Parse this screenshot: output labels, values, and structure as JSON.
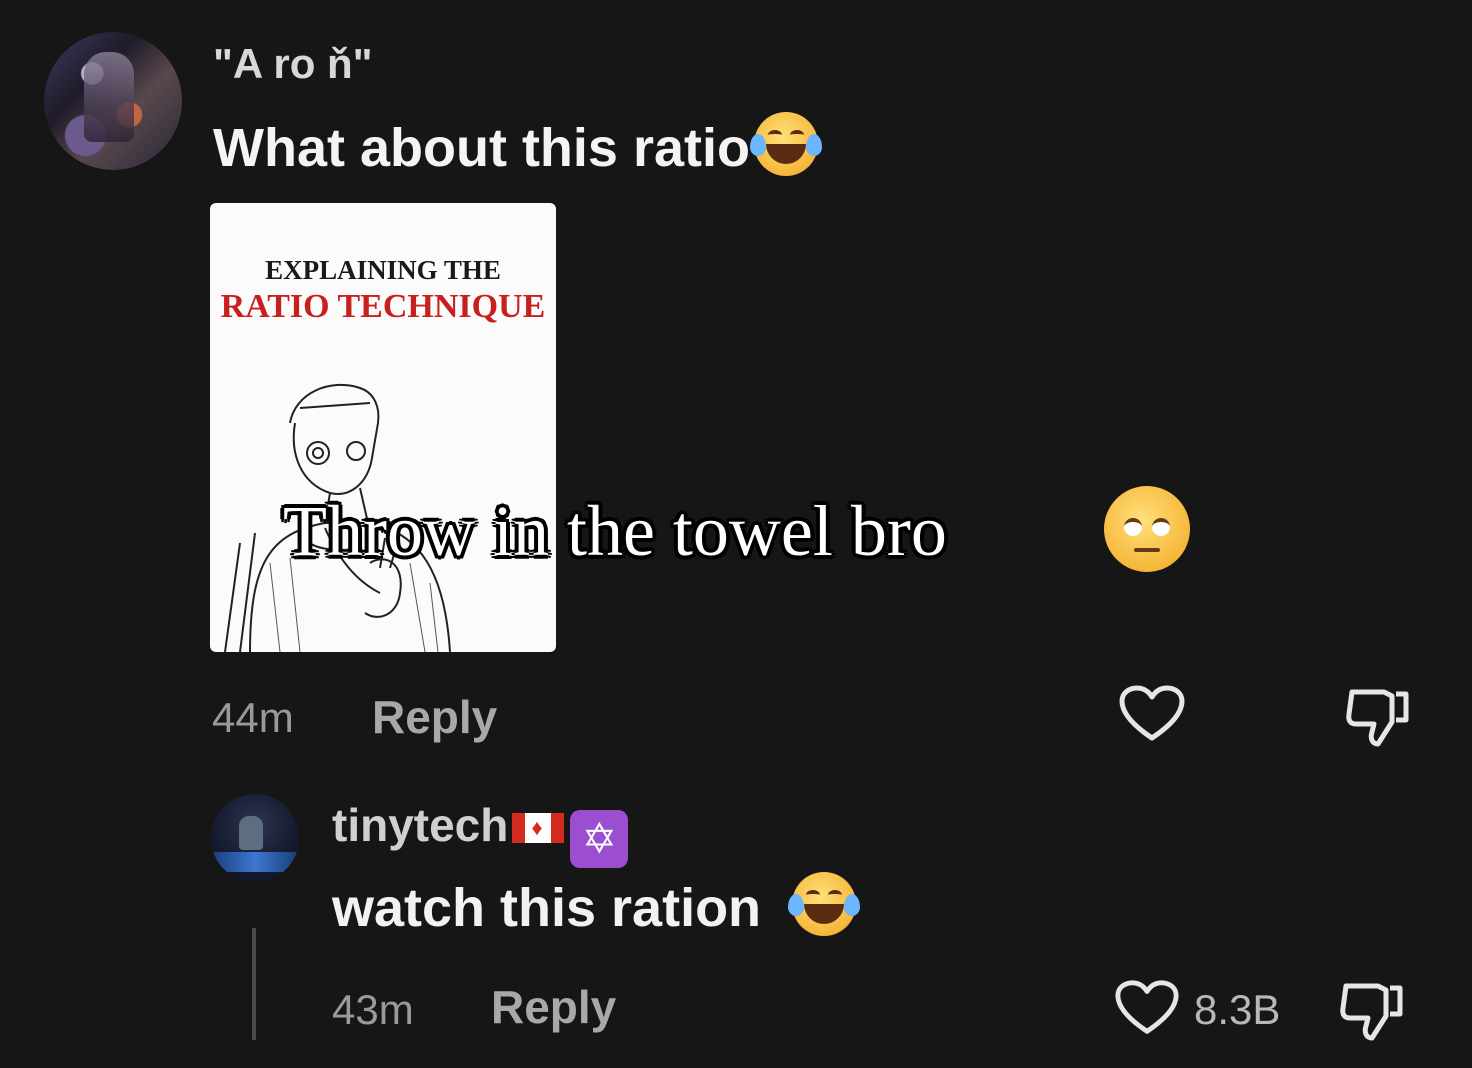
{
  "comment": {
    "username": "\"A ro ň\"",
    "text": "What about this ratio",
    "image_card": {
      "line1": "EXPLAINING THE",
      "line2": "RATIO TECHNIQUE"
    },
    "overlay_caption": "Throw in the towel bro",
    "time": "44m",
    "reply_label": "Reply"
  },
  "reply": {
    "username": "tinytech",
    "text": "watch this ration",
    "time": "43m",
    "reply_label": "Reply",
    "like_count": "8.3B"
  },
  "icons": {
    "emoji_1": "face-with-tears-of-joy-icon",
    "emoji_2": "pensive-face-icon",
    "emoji_3": "face-with-tears-of-joy-icon",
    "flag": "canada-flag-icon",
    "badge": "star-of-david-icon",
    "like": "heart-icon",
    "dislike": "thumbs-down-icon"
  },
  "colors": {
    "background": "#161616",
    "badge_purple": "#9b4fd0",
    "technique_red": "#c81f1f"
  }
}
